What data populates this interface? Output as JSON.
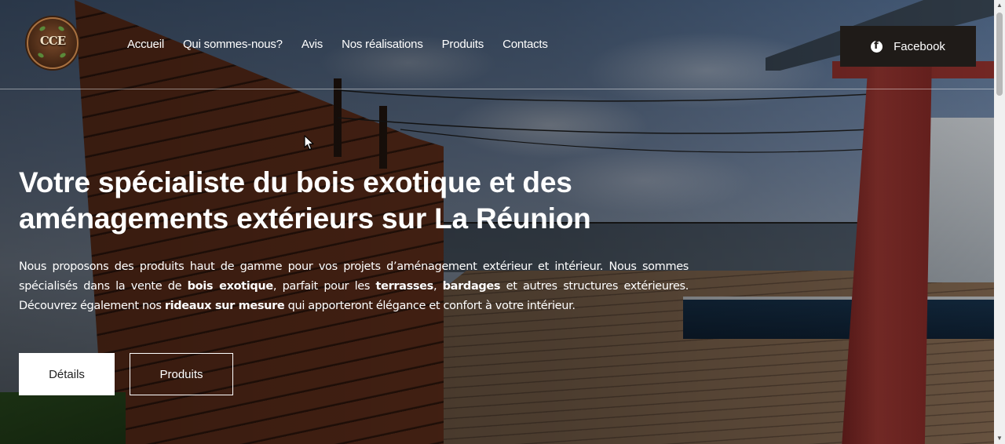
{
  "header": {
    "logo_text": "CCE",
    "nav": [
      "Accueil",
      "Qui sommes-nous?",
      "Avis",
      "Nos réalisations",
      "Produits",
      "Contacts"
    ],
    "facebook_label": "Facebook"
  },
  "hero": {
    "title_line1": "Votre spécialiste du bois exotique et des",
    "title_line2": "aménagements extérieurs sur La Réunion",
    "text": {
      "p1": "Nous proposons des produits haut de gamme pour vos projets d’aménagement extérieur et intérieur. Nous sommes spécialisés dans la vente de ",
      "b1": "bois exotique",
      "p2": ", parfait pour les ",
      "b2": "terrasses",
      "p3": ", ",
      "b3": "bardages",
      "p4": " et autres structures extérieures. Découvrez également nos ",
      "b4": "rideaux sur mesure",
      "p5": " qui apporteront élégance et confort à votre intérieur."
    },
    "buttons": {
      "details": "Détails",
      "products": "Produits"
    }
  },
  "icons": {
    "facebook": "facebook-icon",
    "cursor": "mouse-cursor-icon"
  },
  "colors": {
    "facebook_button_bg": "#1f1b18",
    "primary_button_bg": "#ffffff"
  }
}
